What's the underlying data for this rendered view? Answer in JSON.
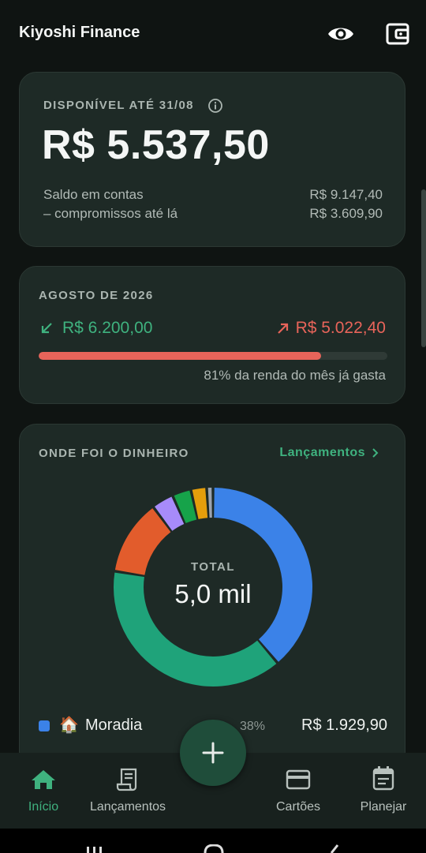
{
  "header": {
    "title": "Kiyoshi Finance",
    "visibility_icon": "eye-icon",
    "wallet_icon": "wallet-icon"
  },
  "available": {
    "label": "DISPONÍVEL ATÉ 31/08",
    "info_icon": "info-icon",
    "amount": "R$ 5.537,50",
    "rows": [
      {
        "label": "Saldo em contas",
        "value": "R$ 9.147,40"
      },
      {
        "label": "– compromissos até lá",
        "value": "R$ 3.609,90"
      }
    ]
  },
  "month": {
    "label": "AGOSTO DE 2026",
    "income": "R$ 6.200,00",
    "expense": "R$ 5.022,40",
    "spent_fraction": 0.81,
    "caption": "81% da renda do mês já gasta",
    "colors": {
      "income": "#3fb27f",
      "expense": "#e8645a"
    }
  },
  "spending": {
    "label": "ONDE FOI O DINHEIRO",
    "link": "Lançamentos",
    "total_label": "TOTAL",
    "total_value": "5,0 mil",
    "legend": [
      {
        "emoji": "🏠",
        "name": "Moradia",
        "percent": "38%",
        "value": "R$ 1.929,90",
        "color": "#3b82e8"
      }
    ]
  },
  "chart_data": {
    "type": "pie",
    "title": "",
    "slices": [
      {
        "label": "Moradia",
        "percent": 38,
        "color": "#3b82e8"
      },
      {
        "label": "",
        "percent": 38,
        "color": "#1fa37a"
      },
      {
        "label": "",
        "percent": 12,
        "color": "#e25c2c"
      },
      {
        "label": "",
        "percent": 3.5,
        "color": "#a78bfa"
      },
      {
        "label": "",
        "percent": 3,
        "color": "#16a34a"
      },
      {
        "label": "",
        "percent": 2.5,
        "color": "#e59e0b"
      },
      {
        "label": "",
        "percent": 1,
        "color": "#9ca3af"
      }
    ]
  },
  "nav": {
    "items": [
      {
        "label": "Início",
        "icon": "home-icon",
        "active": true
      },
      {
        "label": "Lançamentos",
        "icon": "receipt-icon",
        "active": false
      },
      {
        "label": "Cartões",
        "icon": "credit-card-icon",
        "active": false
      },
      {
        "label": "Planejar",
        "icon": "calendar-icon",
        "active": false
      }
    ],
    "fab_icon": "plus-icon",
    "active_color": "#3fb27f"
  }
}
